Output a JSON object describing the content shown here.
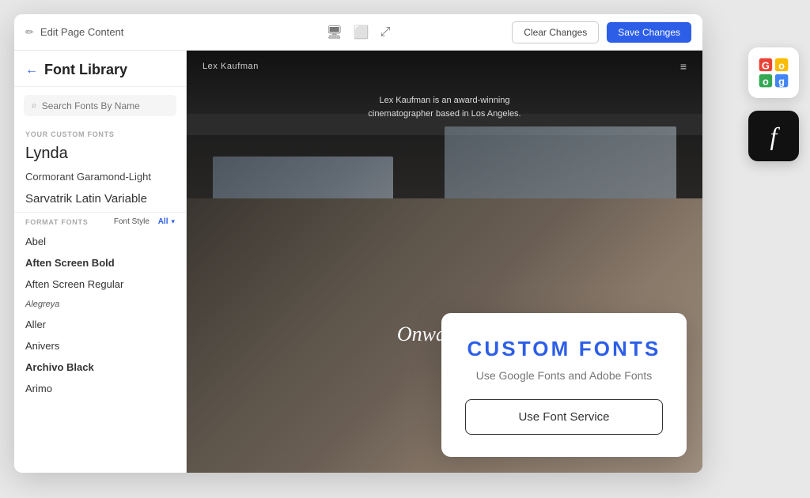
{
  "app": {
    "title": "Font Library",
    "edit_label": "Edit Page Content",
    "clear_btn": "Clear Changes",
    "save_btn": "Save Changes"
  },
  "sidebar": {
    "title": "Font Library",
    "search_placeholder": "Search Fonts By Name",
    "custom_fonts_section": "YOUR CUSTOM FONTS",
    "format_fonts_section": "FORMAT FONTS",
    "font_style_label": "Font Style",
    "font_style_value": "All",
    "custom_fonts": [
      {
        "name": "Lynda",
        "size": "large"
      },
      {
        "name": "Cormorant Garamond-Light",
        "size": "medium"
      },
      {
        "name": "Sarvatrik Latin Variable",
        "size": "medium"
      }
    ],
    "format_fonts": [
      {
        "name": "Abel",
        "weight": "normal"
      },
      {
        "name": "Aften Screen Bold",
        "weight": "bold"
      },
      {
        "name": "Aften Screen Regular",
        "weight": "normal"
      },
      {
        "name": "Alegreya",
        "weight": "normal",
        "style": "italic-small"
      },
      {
        "name": "Aller",
        "weight": "normal"
      },
      {
        "name": "Anivers",
        "weight": "normal"
      },
      {
        "name": "Archivo Black",
        "weight": "bold"
      },
      {
        "name": "Arimo",
        "weight": "normal"
      }
    ]
  },
  "canvas": {
    "site_name": "Lex Kaufman",
    "hero_line1": "Lex Kaufman is an award-winning",
    "hero_line2": "cinematographer based in Los Angeles.",
    "cta_text": "Onward",
    "menu_icon": "≡"
  },
  "custom_fonts_card": {
    "title": "CUSTOM  FONTS",
    "subtitle": "Use Google Fonts and Adobe Fonts",
    "button_label": "Use Font Service"
  },
  "icons": {
    "back_arrow": "←",
    "search": "🔍",
    "edit_pencil": "✏",
    "monitor": "🖥",
    "tablet": "⬜",
    "expand": "⤢",
    "chevron_down": "▾",
    "cta_arrow": "›",
    "google_colors": [
      "#EA4335",
      "#FBBC05",
      "#34A853",
      "#4285F4"
    ],
    "adobe_letter": "f"
  }
}
